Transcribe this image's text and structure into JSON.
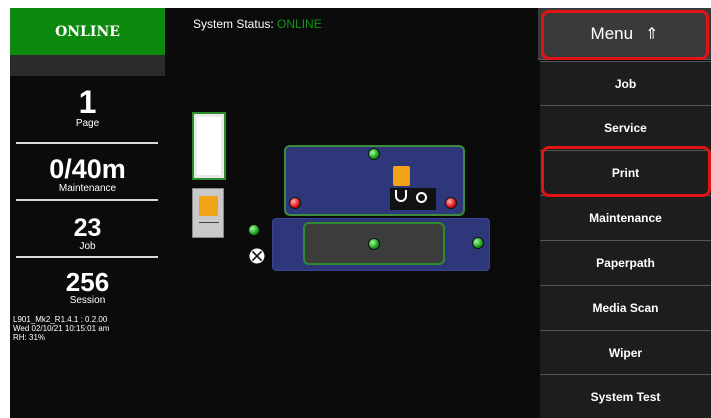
{
  "left_panel": {
    "status_badge": "ONLINE",
    "stats": [
      {
        "value": "1",
        "label": "Page"
      },
      {
        "value": "0/40m",
        "label": "Maintenance"
      },
      {
        "value": "23",
        "label": "Job"
      },
      {
        "value": "256",
        "label": "Session"
      }
    ],
    "info_lines": [
      "L901_Mk2_R1.4.1 : 0.2.00",
      "Wed 02/10/21 10:15:01 am",
      "RH: 31%"
    ]
  },
  "header": {
    "status_label": "System Status:",
    "status_value": "ONLINE"
  },
  "menu": {
    "button_label": "Menu",
    "button_arrow": "⇑",
    "items": [
      {
        "label": "Job"
      },
      {
        "label": "Service"
      },
      {
        "label": "Print"
      },
      {
        "label": "Maintenance"
      },
      {
        "label": "Paperpath"
      },
      {
        "label": "Media Scan"
      },
      {
        "label": "Wiper"
      },
      {
        "label": "System Test"
      }
    ]
  },
  "colors": {
    "online_green": "#0d8a0d",
    "highlight_red": "#e01414",
    "panel_blue": "#2e377a",
    "ink_yellow": "#f0a316"
  }
}
